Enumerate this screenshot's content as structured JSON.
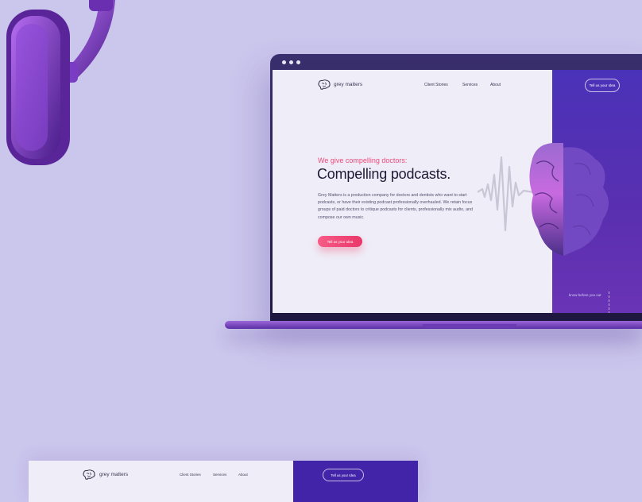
{
  "site": {
    "logo_text": "grey matters",
    "nav": [
      "Client Stories",
      "Services",
      "About"
    ],
    "cta_top": "Tell us your Idea"
  },
  "hero": {
    "tagline": "We give compelling doctors:",
    "headline": "Compelling podcasts.",
    "body": "Grey Matters is a production company for doctors and dentists who want to start podcasts, or have their existing podcast professionally overhauled. We retain focus groups of paid doctors to critique podcasts for clients, professionally mix audio, and compose our own music.",
    "cta": "Tell us your Idea",
    "scroll_hint": "know before you out"
  },
  "preview": {
    "logo_text": "grey matters",
    "nav": [
      "Client Stories",
      "Services",
      "About"
    ],
    "cta": "Tell us your Idea"
  },
  "colors": {
    "background": "#cbc6ec",
    "accent_pink": "#ef4a7a",
    "panel_purple": "#4a32b8"
  }
}
